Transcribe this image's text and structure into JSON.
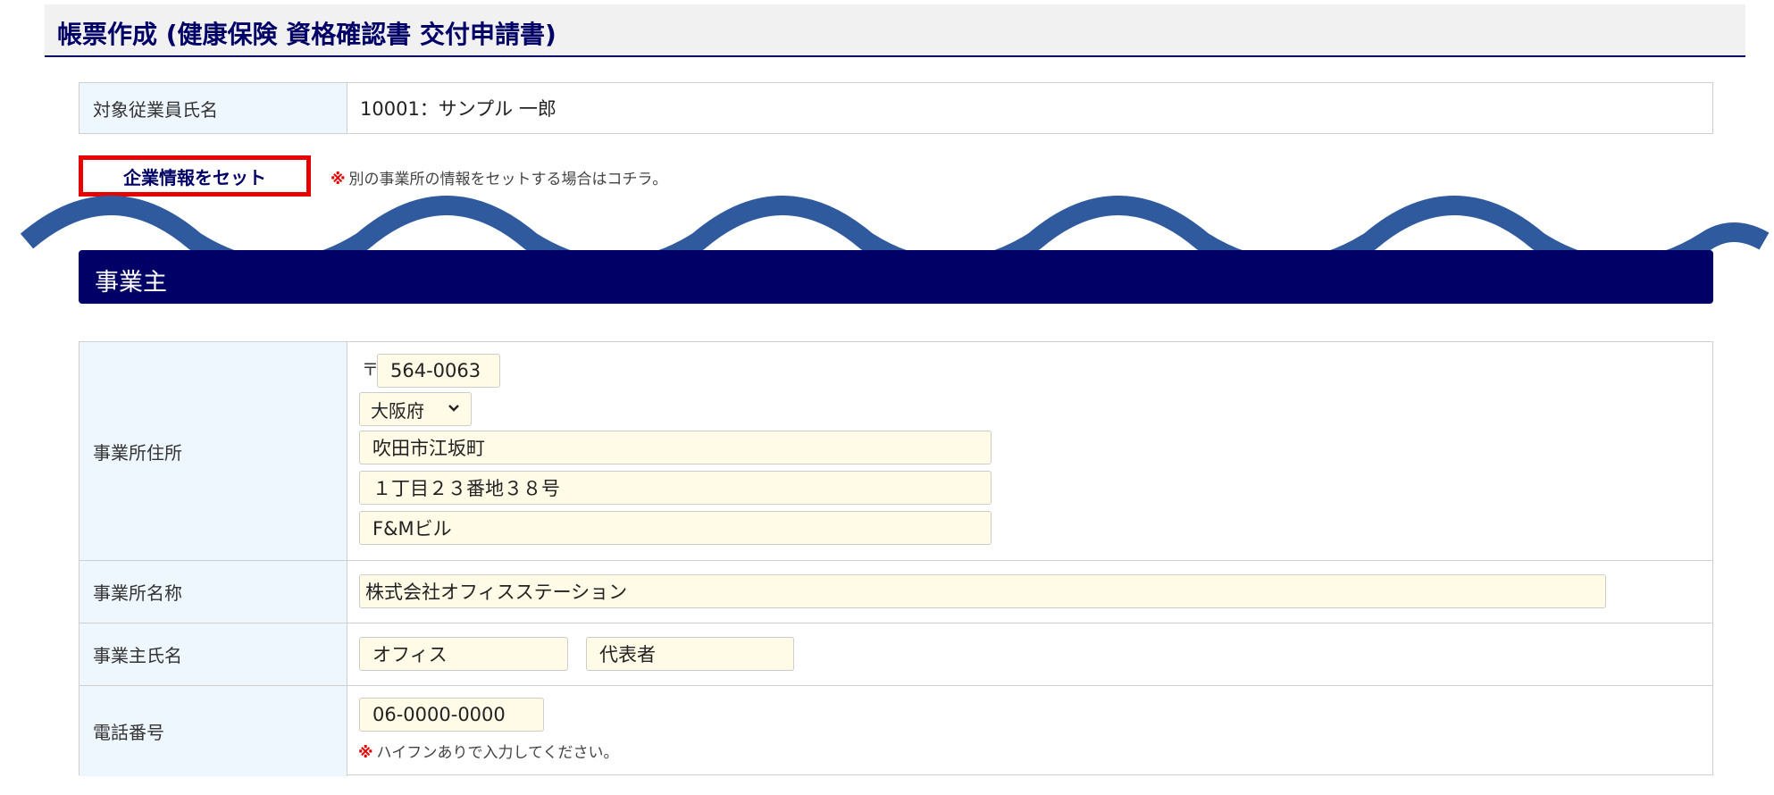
{
  "page": {
    "title": "帳票作成 (健康保険 資格確認書 交付申請書)"
  },
  "employee": {
    "label": "対象従業員氏名",
    "value": "10001：サンプル 一郎"
  },
  "company_set": {
    "button_label": "企業情報をセット",
    "note_mark": "※",
    "note_text": "別の事業所の情報をセットする場合はコチラ。"
  },
  "section": {
    "title": "事業主"
  },
  "form": {
    "address": {
      "label": "事業所住所",
      "zip_mark": "〒",
      "zip": "564-0063",
      "prefecture": "大阪府",
      "line1": "吹田市江坂町",
      "line2": "１丁目２３番地３８号",
      "line3": "F&Mビル"
    },
    "office_name": {
      "label": "事業所名称",
      "value": "株式会社オフィスステーション"
    },
    "owner_name": {
      "label": "事業主氏名",
      "last": "オフィス",
      "first": "代表者"
    },
    "phone": {
      "label": "電話番号",
      "value": "06-0000-0000",
      "note_mark": "※",
      "note_text": "ハイフンありで入力してください。"
    }
  },
  "colors": {
    "brand_navy": "#000066",
    "wave_blue": "#2f5a9e",
    "highlight_red": "#e60000",
    "input_bg": "#fffbe6",
    "label_bg": "#eef6fe"
  },
  "icons": {
    "select_chevron": "chevron-down-icon"
  }
}
